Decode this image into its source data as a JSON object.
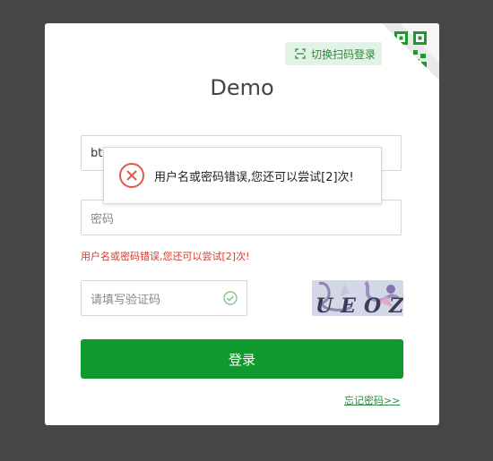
{
  "header": {
    "qr_switch_label": "切换扫码登录",
    "title": "Demo"
  },
  "form": {
    "username_value": "bt",
    "password_placeholder": "密码",
    "error_message": "用户名或密码错误,您还可以尝试[2]次!",
    "captcha_placeholder": "请填写验证码",
    "captcha_text": "UEOZ",
    "login_button": "登录",
    "forgot_link": "忘记密码>>"
  },
  "toast": {
    "message": "用户名或密码错误,您还可以尝试[2]次!"
  },
  "colors": {
    "background": "#464646",
    "primary_green": "#109a2d",
    "error_red": "#d33b2c"
  }
}
